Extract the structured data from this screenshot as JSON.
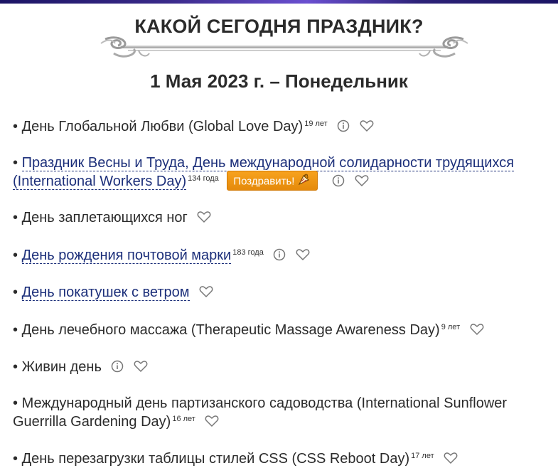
{
  "page": {
    "title": "КАКОЙ СЕГОДНЯ ПРАЗДНИК?",
    "date": "1 Мая 2023 г. – Понедельник"
  },
  "holidays": [
    {
      "bullet": "• ",
      "text": "День Глобальной Любви (Global Love Day)",
      "age": "19 лет",
      "link": false
    },
    {
      "bullet": "• ",
      "text": "Праздник Весны и Труда, День международной солидарности трудящихся (International Workers Day)",
      "age": "134 года",
      "link": true,
      "button": "Поздравить!"
    },
    {
      "bullet": "• ",
      "text": "День заплетающихся ног",
      "link": false
    },
    {
      "bullet": "• ",
      "text": "День рождения почтовой марки",
      "age": "183 года",
      "link": true
    },
    {
      "bullet": "• ",
      "text": "День покатушек с ветром",
      "link": true
    },
    {
      "bullet": "• ",
      "text": "День лечебного массажа (Therapeutic Massage Awareness Day)",
      "age": "9 лет",
      "link": false
    },
    {
      "bullet": "• ",
      "text": "Живин день",
      "link": false
    },
    {
      "bullet": "• ",
      "text": "Международный день партизанского садоводства (International Sunflower Guerrilla Gardening Day)",
      "age": "16 лет",
      "link": false
    },
    {
      "bullet": "• ",
      "text": "День перезагрузки таблицы стилей CSS (CSS Reboot Day)",
      "age": "17 лет",
      "link": false
    }
  ],
  "icons": {
    "info": "info-icon",
    "favorite": "heart-icon",
    "gift": "gift-icon"
  },
  "colors": {
    "link": "#1c2f7a",
    "button": "#f39a17",
    "text": "#2b2b2b"
  }
}
